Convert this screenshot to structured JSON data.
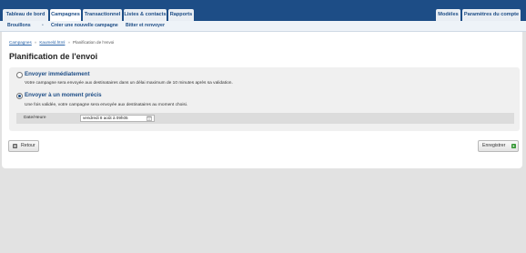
{
  "nav": {
    "tabs": [
      {
        "label": "Tableau de bord"
      },
      {
        "label": "Campagnes"
      },
      {
        "label": "Transactionnel"
      },
      {
        "label": "Listes & contacts"
      },
      {
        "label": "Rapports"
      }
    ],
    "right_tabs": [
      {
        "label": "Modèles"
      },
      {
        "label": "Paramètres du compte"
      }
    ]
  },
  "subnav": {
    "items": [
      "Brouillons",
      "Créer une nouvelle campagne",
      "Bitter et renvoyer"
    ],
    "separator": "•"
  },
  "breadcrumb": {
    "items": [
      "Campagnes",
      "Kaumeld.html",
      "Planification de l'envoi"
    ],
    "separator": "»"
  },
  "page": {
    "title": "Planification de l'envoi"
  },
  "options": {
    "now": {
      "label": "Envoyer immédiatement",
      "description": "Votre campagne sera envoyée aux destinataires dans un délai maximum de 10 minutes après sa validation.",
      "selected": false
    },
    "scheduled": {
      "label": "Envoyer à un moment précis",
      "description": "Une fois validée, votre campagne sera envoyée aux destinataires au moment choisi.",
      "selected": true
    }
  },
  "datetime": {
    "label": "Date/Heure",
    "value": "vendredi 8 août à 09h05"
  },
  "buttons": {
    "back": "Retour",
    "save": "Enregistrer"
  },
  "colors": {
    "brand": "#1d4d86",
    "save_icon": "#3a9a3a"
  }
}
